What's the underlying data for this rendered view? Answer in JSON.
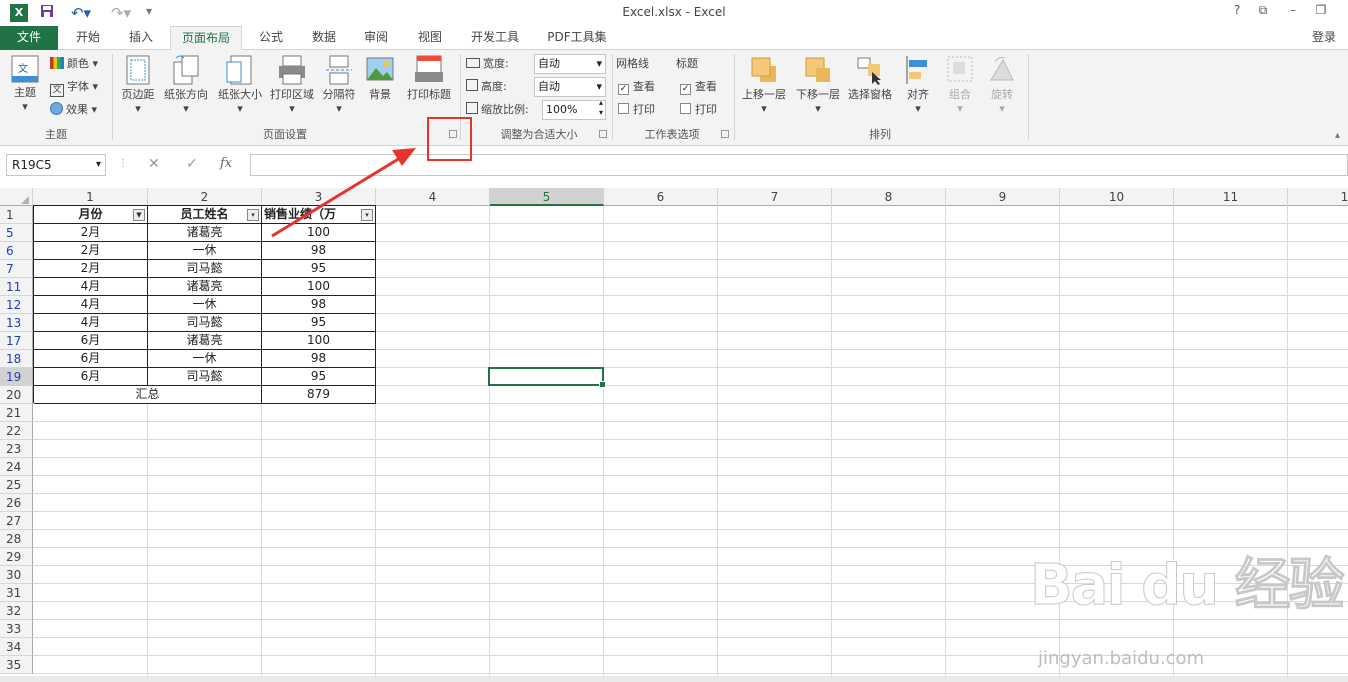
{
  "titlebar": {
    "title": "Excel.xlsx - Excel",
    "help": "?"
  },
  "tabs": [
    "文件",
    "开始",
    "插入",
    "页面布局",
    "公式",
    "数据",
    "审阅",
    "视图",
    "开发工具",
    "PDF工具集"
  ],
  "login": "登录",
  "ribbon": {
    "theme": {
      "main": "主题",
      "colors": "颜色",
      "fonts": "字体",
      "effects": "效果",
      "group": "主题"
    },
    "page_setup": {
      "margins": "页边距",
      "orientation": "纸张方向",
      "size": "纸张大小",
      "print_area": "打印区域",
      "breaks": "分隔符",
      "background": "背景",
      "print_titles": "打印标题",
      "group": "页面设置"
    },
    "scale": {
      "width_label": "宽度:",
      "width_value": "自动",
      "height_label": "高度:",
      "height_value": "自动",
      "scale_label": "缩放比例:",
      "scale_value": "100%",
      "group": "调整为合适大小"
    },
    "sheet_options": {
      "gridlines": "网格线",
      "headings": "标题",
      "view": "查看",
      "view2": "查看",
      "print": "打印",
      "print2": "打印",
      "group": "工作表选项"
    },
    "arrange": {
      "bring_forward": "上移一层",
      "send_backward": "下移一层",
      "selection_pane": "选择窗格",
      "align": "对齐",
      "group_btn": "组合",
      "rotate": "旋转",
      "group": "排列"
    }
  },
  "formula_bar": {
    "name_box": "R19C5",
    "fx": "fx",
    "cancel": "✕",
    "enter": "✓",
    "value": ""
  },
  "columns": [
    "1",
    "2",
    "3",
    "4",
    "5",
    "6",
    "7",
    "8",
    "9",
    "10",
    "11",
    "1"
  ],
  "rows": [
    "1",
    "5",
    "6",
    "7",
    "11",
    "12",
    "13",
    "17",
    "18",
    "19",
    "20",
    "21",
    "22",
    "23",
    "24",
    "25",
    "26",
    "27",
    "28",
    "29",
    "30",
    "31",
    "32",
    "33",
    "34",
    "35"
  ],
  "filtered_rows": [
    "5",
    "6",
    "7",
    "11",
    "12",
    "13",
    "17",
    "18",
    "19"
  ],
  "table": {
    "headers": [
      "月份",
      "员工姓名",
      "销售业绩（万"
    ],
    "data": [
      [
        "2月",
        "诸葛亮",
        "100"
      ],
      [
        "2月",
        "一休",
        "98"
      ],
      [
        "2月",
        "司马懿",
        "95"
      ],
      [
        "4月",
        "诸葛亮",
        "100"
      ],
      [
        "4月",
        "一休",
        "98"
      ],
      [
        "4月",
        "司马懿",
        "95"
      ],
      [
        "6月",
        "诸葛亮",
        "100"
      ],
      [
        "6月",
        "一休",
        "98"
      ],
      [
        "6月",
        "司马懿",
        "95"
      ]
    ],
    "total_label": "汇总",
    "total_value": "879"
  },
  "watermark": {
    "main": "Bai du 经验",
    "sub": "jingyan.baidu.com"
  },
  "colors": {
    "accent": "#217346",
    "annotation": "#e8322c"
  }
}
